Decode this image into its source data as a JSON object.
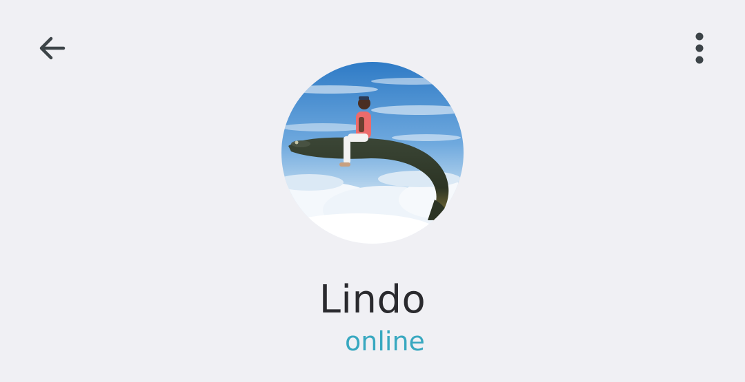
{
  "header": {
    "back_icon": "arrow-left-icon",
    "menu_icon": "more-vertical-icon",
    "icon_color": "#3d4448"
  },
  "profile": {
    "name": "Lindo",
    "status": "online",
    "status_color": "#38a8c0",
    "avatar_description_icon": "profile-photo"
  }
}
